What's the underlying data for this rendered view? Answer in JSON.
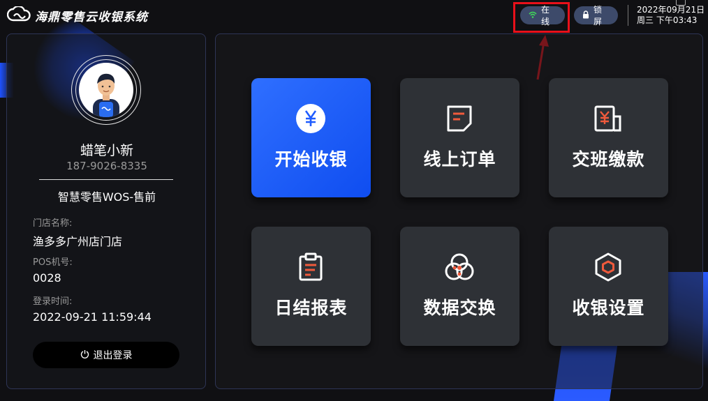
{
  "header": {
    "app_title": "海鼎零售云收银系统",
    "status_online": "在线",
    "lock_label": "锁屏",
    "date_line": "2022年09月21日",
    "time_line": "周三 下午03:43"
  },
  "user": {
    "name": "蜡笔小新",
    "phone": "187-9026-8335",
    "org": "智慧零售WOS-售前",
    "store_label": "门店名称:",
    "store_value": "渔多多广州店门店",
    "pos_label": "POS机号:",
    "pos_value": "0028",
    "login_label": "登录时间:",
    "login_value": "2022-09-21 11:59:44",
    "logout_label": "退出登录"
  },
  "tiles": [
    {
      "label": "开始收银",
      "icon": "yen-coin-icon"
    },
    {
      "label": "线上订单",
      "icon": "document-icon"
    },
    {
      "label": "交班缴款",
      "icon": "yen-receipt-icon"
    },
    {
      "label": "日结报表",
      "icon": "clipboard-icon"
    },
    {
      "label": "数据交换",
      "icon": "exchange-circles-icon"
    },
    {
      "label": "收银设置",
      "icon": "hexagon-settings-icon"
    }
  ],
  "colors": {
    "accent": "#1f5cff",
    "icon_orange": "#f05a3c",
    "highlight": "#e8101a",
    "wifi_green": "#41d85a"
  }
}
